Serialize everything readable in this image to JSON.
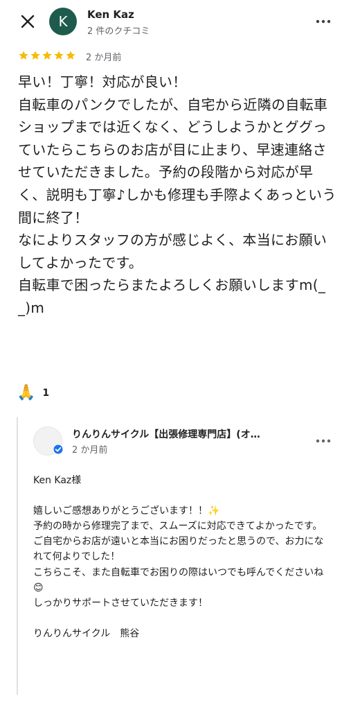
{
  "header": {
    "close_icon": "close-icon",
    "avatar_letter": "K",
    "reviewer_name": "Ken Kaz",
    "review_count": "2 件のクチコミ",
    "more_icon": "more-vert-icon"
  },
  "rating": {
    "stars": 5,
    "max": 5,
    "date": "2 か月前",
    "star_color": "#f6bb06"
  },
  "review_text": [
    "早い！丁寧！対応が良い！",
    "自転車のパンクでしたが、自宅から近隣の自転車ショップまでは近くなく、どうしようかとググっていたらこちらのお店が目に止まり、早速連絡させていただきました。予約の段階から対応が早く、説明も丁寧♪しかも修理も手際よくあっという間に終了！",
    "なによりスタッフの方が感じよく、本当にお願いしてよかったです。",
    "自転車で困ったらまたよろしくお願いしますm(_ _)m"
  ],
  "reaction": {
    "emoji": "🙏",
    "count": "1"
  },
  "owner_reply": {
    "name": "りんりんサイクル【出張修理専門店】(オ…",
    "date": "2 か月前",
    "verified_color": "#1a73e8",
    "lines": [
      "Ken Kaz様",
      "",
      "嬉しいご感想ありがとうございます！！✨",
      "予約の時から修理完了まで、スムーズに対応できてよかったです。",
      "ご自宅からお店が遠いと本当にお困りだったと思うので、お力になれて何よりでした！",
      "こちらこそ、また自転車でお困りの際はいつでも呼んでくださいね😊",
      "しっかりサポートさせていただきます！",
      "",
      "りんりんサイクル　熊谷"
    ]
  }
}
